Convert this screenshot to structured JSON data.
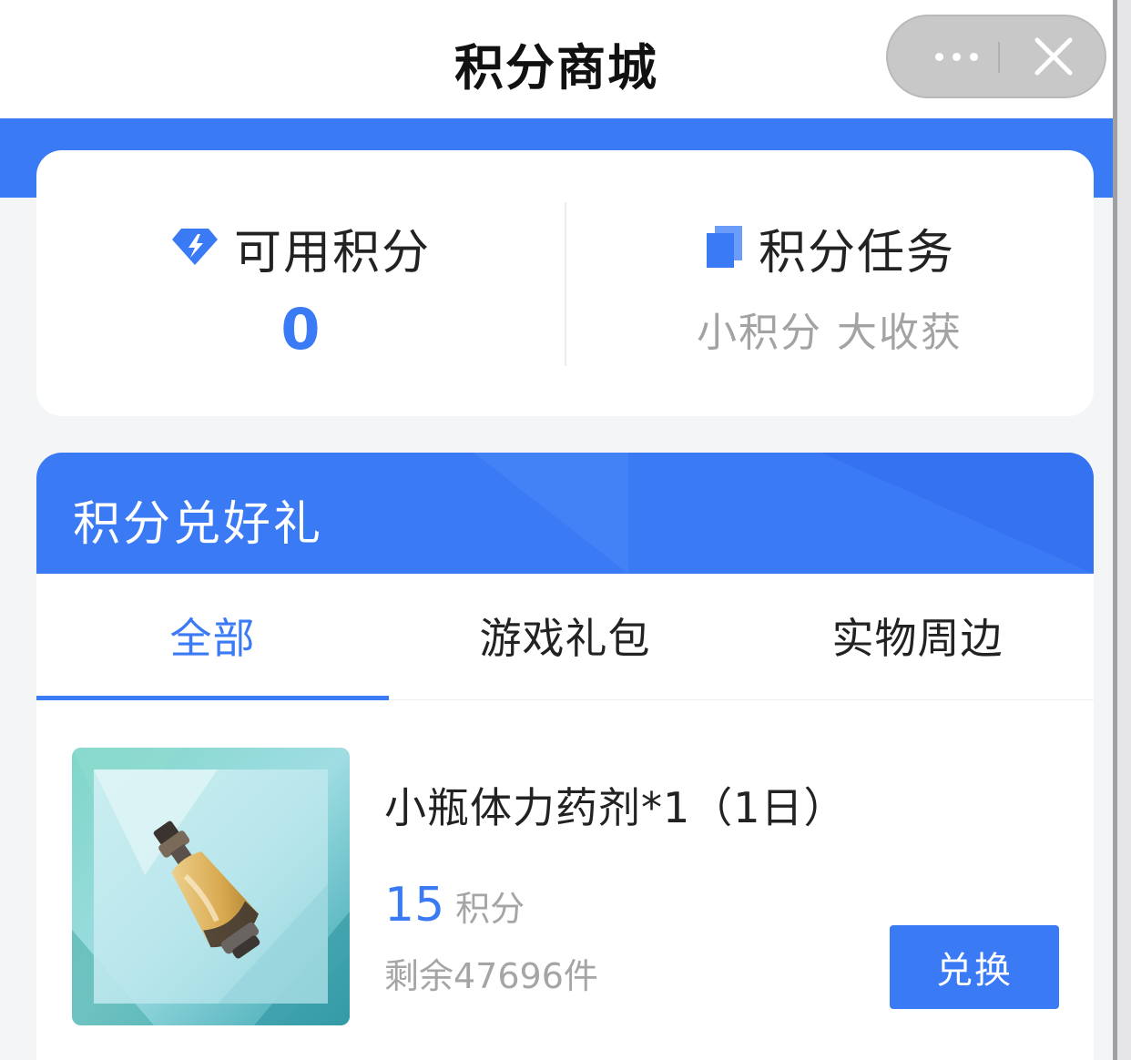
{
  "header": {
    "title": "积分商城",
    "more_icon": "more-dots-icon",
    "close_icon": "close-icon"
  },
  "points_card": {
    "available": {
      "label": "可用积分",
      "value": "0",
      "icon": "diamond-icon"
    },
    "tasks": {
      "label": "积分任务",
      "subtitle": "小积分 大收获",
      "icon": "document-icon"
    }
  },
  "exchange": {
    "title": "积分兑好礼",
    "tabs": [
      {
        "label": "全部",
        "active": true
      },
      {
        "label": "游戏礼包",
        "active": false
      },
      {
        "label": "实物周边",
        "active": false
      }
    ],
    "products": [
      {
        "name": "小瓶体力药剂*1（1日）",
        "price": "15",
        "unit": "积分",
        "stock": "剩余47696件",
        "button": "兑换",
        "image": "potion-bottle-image"
      }
    ]
  },
  "colors": {
    "primary": "#3a7af5",
    "text": "#222222",
    "muted": "#a3a3a3",
    "background": "#f4f5f7"
  }
}
